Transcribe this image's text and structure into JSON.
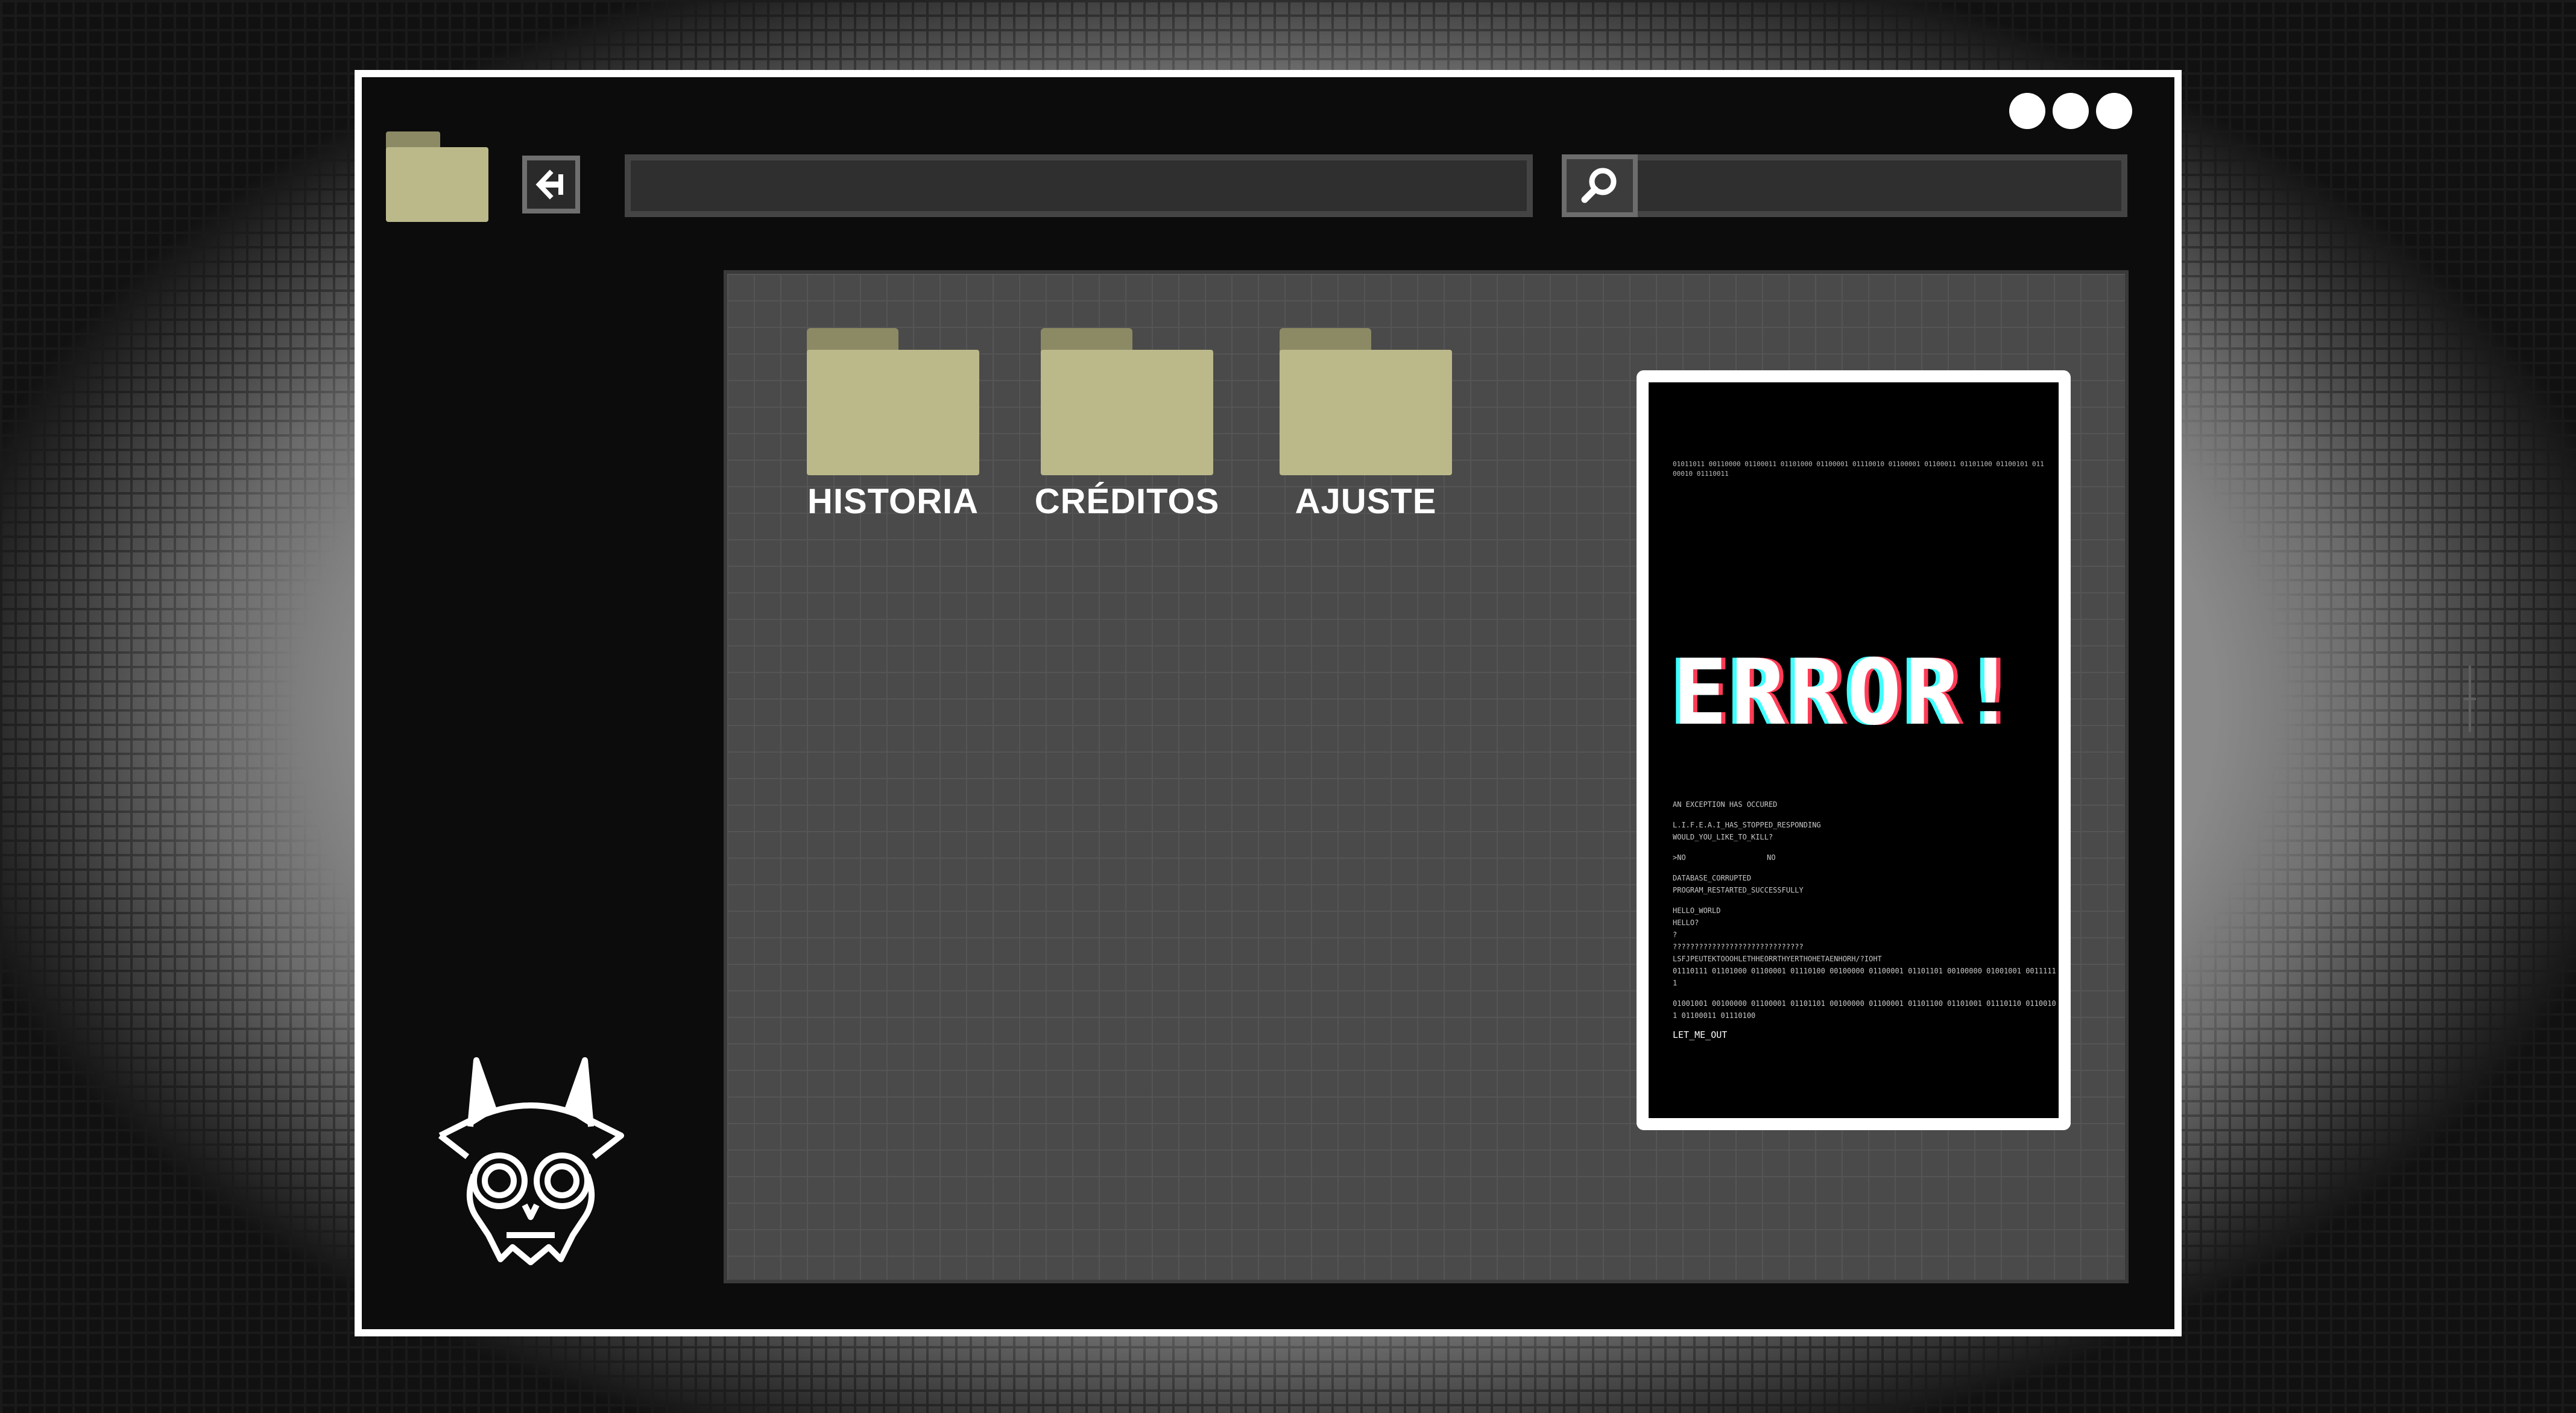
{
  "window": {
    "controls": [
      "dot",
      "dot",
      "dot"
    ]
  },
  "toolbar": {
    "folder_icon": "folder-icon",
    "back_icon": "back-arrow-icon",
    "address_value": "",
    "search_icon": "search-icon",
    "search_value": ""
  },
  "desktop": {
    "folders": [
      {
        "label": "HISTORIA",
        "icon": "folder-icon"
      },
      {
        "label": "CRÉDITOS",
        "icon": "folder-icon"
      },
      {
        "label": "AJUSTE",
        "icon": "folder-icon"
      }
    ]
  },
  "error": {
    "binary_top": "01011011 00110000 01100011 01101000 01100001 01110010 01100001 01100011 01101100 01100101 01100010 01110011",
    "title": "ERROR!",
    "line1": "AN EXCEPTION HAS OCCURED",
    "line2": "L.I.F.E.A.I_HAS_STOPPED_RESPONDING",
    "line3": "WOULD_YOU_LIKE_TO_KILL?",
    "option_no": ">NO",
    "option_no2": "NO",
    "line4": "DATABASE_CORRUPTED",
    "line5": "PROGRAM_RESTARTED_SUCCESSFULLY",
    "line6": "HELLO_WORLD",
    "line7": "HELLO?",
    "line8": "?",
    "line9": "??????????????????????????????",
    "line10": "LSFJPEUTEKTOOOHLETHHEORRTHYERTHOHETAENHORH/?IOHT",
    "binary_mid": "01110111 01101000 01100001 01110100 00100000 01100001 01101101 00100000 01001001 00111111",
    "binary_low": "01001001 00100000 01100001 01101101 00100000 01100001 01101100 01101001 01110110 01100101 01100011 01110100",
    "line_out": "LET_ME_OUT",
    "colors": {
      "glitch_cyan": "#40ffff",
      "glitch_red": "#ff3b56"
    }
  },
  "mascot": {
    "icon": "horned-skull-icon"
  },
  "colors": {
    "folder_body": "#bbb98a",
    "folder_tab": "#8c8a64",
    "window_bg": "#0c0c0c",
    "content_bg": "#4a4a4a"
  }
}
